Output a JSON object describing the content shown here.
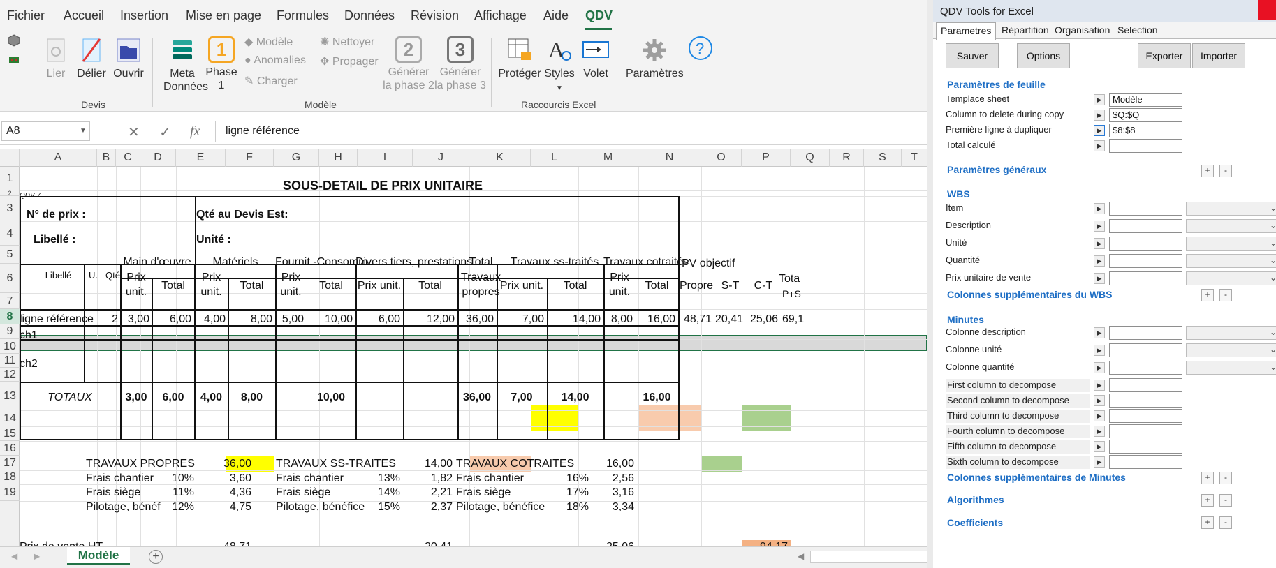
{
  "menu": [
    "Fichier",
    "Accueil",
    "Insertion",
    "Mise en page",
    "Formules",
    "Données",
    "Révision",
    "Affichage",
    "Aide",
    "QDV"
  ],
  "ribbon": {
    "devis": {
      "lier": "Lier",
      "delier": "Délier",
      "ouvrir": "Ouvrir",
      "label": "Devis"
    },
    "modele": {
      "meta1": "Meta",
      "meta2": "Données",
      "phase_num": "1",
      "phase1": "Phase",
      "phase2": "1",
      "modele": "Modèle",
      "anomalies": "Anomalies",
      "charger": "Charger",
      "nettoyer": "Nettoyer",
      "propager": "Propager",
      "gen2_num": "2",
      "gen2a": "Générer",
      "gen2b": "la phase 2",
      "gen3_num": "3",
      "gen3a": "Générer",
      "gen3b": "la phase 3",
      "label": "Modèle"
    },
    "raccourcis": {
      "proteger": "Protéger",
      "styles": "Styles",
      "volet": "Volet",
      "label": "Raccourcis Excel"
    },
    "parametres": "Paramètres"
  },
  "formula_bar": {
    "name_box": "A8",
    "fx": "fx",
    "formula": "ligne référence"
  },
  "columns": [
    "A",
    "B",
    "C",
    "D",
    "E",
    "F",
    "G",
    "H",
    "I",
    "J",
    "K",
    "L",
    "M",
    "N",
    "O",
    "P",
    "Q",
    "R",
    "S",
    "T"
  ],
  "rows": [
    "1",
    "2",
    "3",
    "4",
    "5",
    "6",
    "7",
    "8",
    "9",
    "10",
    "11",
    "12",
    "13",
    "14",
    "15",
    "16",
    "17",
    "18",
    "19"
  ],
  "sheet": {
    "title": "SOUS-DETAIL DE PRIX UNITAIRE",
    "qdv_tag": "QDV 7",
    "no_prix": "N° de prix :",
    "qte_devis": "Qté au Devis Est:",
    "libelle_label": "Libellé :",
    "unite_label": "Unité :",
    "headers": {
      "libelle": "Libellé",
      "u": "U.",
      "qte": "Qté",
      "main_oeuvre": "Main d'œuvre",
      "materiels": "Matériels",
      "fournit": "Fournit.-Consomm",
      "divers": "Divers tiers, prestations",
      "total_trav1": "Total",
      "total_trav2": "Travaux",
      "total_trav3": "propres",
      "ss_traites": "Travaux ss-traités",
      "cotraites": "Travaux cotraités",
      "pv_objectif": "PV objectif",
      "prix": "Prix",
      "unit": "unit.",
      "total": "Total",
      "prix_unit": "Prix unit.",
      "propre": "Propre",
      "st": "S-T",
      "ct": "C-T",
      "tota": "Tota",
      "ps": "P+S"
    },
    "row8": {
      "label": "ligne référence",
      "qte": "2",
      "d": "3,00",
      "e": "6,00",
      "f": "4,00",
      "g": "8,00",
      "h": "5,00",
      "i": "10,00",
      "j": "6,00",
      "k": "12,00",
      "l": "36,00",
      "m": "7,00",
      "n": "14,00",
      "o": "8,00",
      "p": "16,00",
      "q": "48,71",
      "r": "20,41",
      "s": "25,06",
      "t": "69,1"
    },
    "ch1": "ch1",
    "ch2": "ch2",
    "totaux": {
      "label": "TOTAUX",
      "d": "3,00",
      "e": "6,00",
      "f": "4,00",
      "g": "8,00",
      "i": "10,00",
      "l": "36,00",
      "m": "7,00",
      "n": "14,00",
      "p": "16,00"
    },
    "summary": {
      "tp": "TRAVAUX PROPRES",
      "tp_val": "36,00",
      "tst": "TRAVAUX SS-TRAITES",
      "tst_val": "14,00",
      "tc": "TRAVAUX COTRAITES",
      "tc_val": "16,00",
      "frais_chantier": "Frais chantier",
      "frais_siege": "Frais siège",
      "pilotage1": "Pilotage, bénéf",
      "pilotage2": "Pilotage, bénéfice",
      "a16p": "10%",
      "a16v": "3,60",
      "a17p": "11%",
      "a17v": "4,36",
      "a18p": "12%",
      "a18v": "4,75",
      "b16p": "13%",
      "b16v": "1,82",
      "b17p": "14%",
      "b17v": "2,21",
      "b18p": "15%",
      "b18v": "2,37",
      "c16p": "16%",
      "c16v": "2,56",
      "c17p": "17%",
      "c17v": "3,16",
      "c18p": "18%",
      "c18v": "3,34",
      "pv_ht": "Prix de vente HT",
      "pv1": "48,71",
      "pv2": "20,41",
      "pv3": "25,06",
      "pv_total": "94,17"
    }
  },
  "sheet_tab": "Modèle",
  "colors": {
    "yellow": "#ffff00",
    "salmon": "#f8cbad",
    "green": "#a9d08e",
    "orange": "#f4b183",
    "gray_row": "#d9d9d9",
    "excel_green": "#217346"
  },
  "qdv": {
    "title": "QDV Tools for Excel",
    "tabs": [
      "Parametres",
      "Répartition",
      "Organisation",
      "Selection"
    ],
    "buttons": {
      "sauver": "Sauver",
      "options": "Options",
      "exporter": "Exporter",
      "importer": "Importer"
    },
    "sections": {
      "feuille": "Paramètres de feuille",
      "generaux": "Paramètres généraux",
      "wbs": "WBS",
      "col_wbs": "Colonnes supplémentaires du WBS",
      "minutes": "Minutes",
      "col_minutes": "Colonnes supplémentaires de Minutes",
      "algorithmes": "Algorithmes",
      "coefficients": "Coefficients"
    },
    "feuille": [
      {
        "label": "Templace sheet",
        "value": "Modèle"
      },
      {
        "label": "Column to delete during copy",
        "value": "$Q:$Q"
      },
      {
        "label": "Première ligne à dupliquer",
        "value": "$8:$8"
      },
      {
        "label": "Total calculé",
        "value": ""
      }
    ],
    "wbs": [
      "Item",
      "Description",
      "Unité",
      "Quantité",
      "Prix unitaire de vente"
    ],
    "minutes": [
      "Colonne description",
      "Colonne unité",
      "Colonne quantité"
    ],
    "decompose": [
      "First column to decompose",
      "Second column to decompose",
      "Third column to decompose",
      "Fourth column to decompose",
      "Fifth column to decompose",
      "Sixth column to decompose"
    ],
    "plus": "+",
    "minus": "-"
  }
}
